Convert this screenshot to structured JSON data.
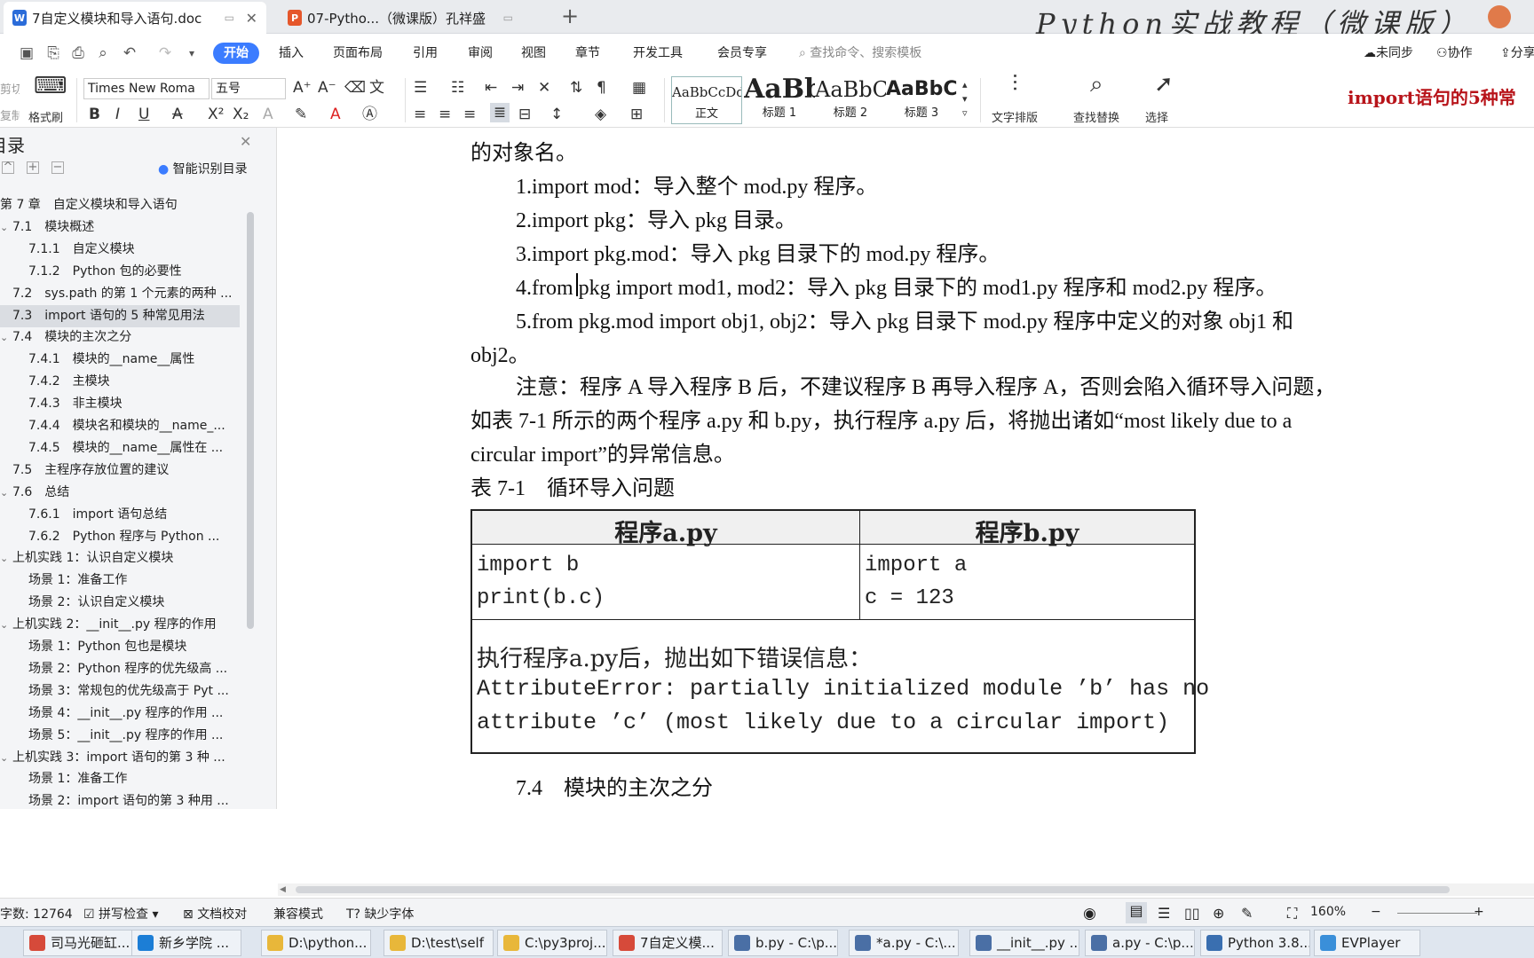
{
  "tabs": [
    {
      "label": "7自定义模块和导入语句.doc",
      "icon": "W",
      "color": "#2b6cd9"
    },
    {
      "label": "07-Pytho...（微课版）孔祥盛",
      "icon": "P",
      "color": "#e5572b"
    }
  ],
  "brand": "Python实战教程（微课版）",
  "menu": [
    "开始",
    "插入",
    "页面布局",
    "引用",
    "审阅",
    "视图",
    "章节",
    "开发工具",
    "会员专享"
  ],
  "search_placeholder": "查找命令、搜索模板",
  "menu_right": [
    "未同步",
    "协作",
    "分享"
  ],
  "ribbon": {
    "clipboard_cut": "剪切",
    "clipboard_copy": "复制",
    "format_painter": "格式刷",
    "font_name": "Times New Roma",
    "font_size": "五号",
    "styles": [
      {
        "sample": "AaBbCcDd",
        "label": "正文"
      },
      {
        "sample": "AaBb",
        "label": "标题 1"
      },
      {
        "sample": "AaBbC",
        "label": "标题 2"
      },
      {
        "sample": "AaBbC",
        "label": "标题 3"
      }
    ],
    "text_layout": "文字排版",
    "find_replace": "查找替换",
    "select": "选择",
    "overlay_text": "import语句的5种常"
  },
  "nav": {
    "title": "目录",
    "smart": "智能识别目录",
    "items": [
      {
        "text": "第 7 章　自定义模块和导入语句",
        "level": 0
      },
      {
        "text": "7.1　模块概述",
        "level": 1
      },
      {
        "text": "7.1.1　自定义模块",
        "level": 2
      },
      {
        "text": "7.1.2　Python 包的必要性",
        "level": 2
      },
      {
        "text": "7.2　sys.path 的第 1 个元素的两种 ...",
        "level": 1
      },
      {
        "text": "7.3　import 语句的 5 种常见用法",
        "level": 1
      },
      {
        "text": "7.4　模块的主次之分",
        "level": 1
      },
      {
        "text": "7.4.1　模块的__name__属性",
        "level": 2
      },
      {
        "text": "7.4.2　主模块",
        "level": 2
      },
      {
        "text": "7.4.3　非主模块",
        "level": 2
      },
      {
        "text": "7.4.4　模块名和模块的__name_...",
        "level": 2
      },
      {
        "text": "7.4.5　模块的__name__属性在 ...",
        "level": 2
      },
      {
        "text": "7.5　主程序存放位置的建议",
        "level": 1
      },
      {
        "text": "7.6　总结",
        "level": 1
      },
      {
        "text": "7.6.1　import 语句总结",
        "level": 2
      },
      {
        "text": "7.6.2　Python 程序与 Python ...",
        "level": 2
      },
      {
        "text": "上机实践 1：认识自定义模块",
        "level": 1
      },
      {
        "text": "场景 1：准备工作",
        "level": 2
      },
      {
        "text": "场景 2：认识自定义模块",
        "level": 2
      },
      {
        "text": "上机实践 2：__init__.py 程序的作用",
        "level": 1
      },
      {
        "text": "场景 1：Python 包也是模块",
        "level": 2
      },
      {
        "text": "场景 2：Python 程序的优先级高 ...",
        "level": 2
      },
      {
        "text": "场景 3：常规包的优先级高于 Pyt ...",
        "level": 2
      },
      {
        "text": "场景 4：__init__.py 程序的作用 ...",
        "level": 2
      },
      {
        "text": "场景 5：__init__.py 程序的作用 ...",
        "level": 2
      },
      {
        "text": "上机实践 3：import 语句的第 3 种 ...",
        "level": 1
      },
      {
        "text": "场景 1：准备工作",
        "level": 2
      },
      {
        "text": "场景 2：import 语句的第 3 种用 ...",
        "level": 2
      }
    ]
  },
  "doc": {
    "p0": "的对象名。",
    "p1": "1.import mod：导入整个 mod.py 程序。",
    "p2": "2.import pkg：导入 pkg 目录。",
    "p3": "3.import pkg.mod：导入 pkg 目录下的 mod.py 程序。",
    "p4": "4.from pkg import mod1, mod2：导入 pkg 目录下的 mod1.py 程序和 mod2.py 程序。",
    "p5": "5.from pkg.mod import obj1, obj2：导入 pkg 目录下 mod.py 程序中定义的对象 obj1 和",
    "p5b": "obj2。",
    "p6": "注意：程序 A 导入程序 B 后，不建议程序 B 再导入程序 A，否则会陷入循环导入问题，",
    "p6b": "如表 7-1 所示的两个程序 a.py 和 b.py，执行程序 a.py 后，将抛出诸如“most likely due to a",
    "p6c": "circular import”的异常信息。",
    "caption": "表 7-1　循环导入问题",
    "table": {
      "h1": "程序a.py",
      "h2": "程序b.py",
      "c1l1": "import b",
      "c1l2": "print(b.c)",
      "c2l1": "import a",
      "c2l2": "c = 123",
      "err_title": "执行程序a.py后，抛出如下错误信息：",
      "err1": "AttributeError: partially initialized module ’b’ has no",
      "err2": "attribute ’c’ (most likely due to a circular import)"
    },
    "heading": "7.4　模块的主次之分"
  },
  "status": {
    "wordcount": "字数: 12764",
    "spell": "拼写检查",
    "proof": "文档校对",
    "compat": "兼容模式",
    "missing_font": "缺少字体",
    "zoom": "160%"
  },
  "taskbar": [
    {
      "label": "司马光砸缸...",
      "color": "#d64a3a"
    },
    {
      "label": "新乡学院 ...",
      "color": "#1c7ed6"
    },
    {
      "label": "D:\\python...",
      "color": "#e8b73a"
    },
    {
      "label": "D:\\test\\self",
      "color": "#e8b73a"
    },
    {
      "label": "C:\\py3proj...",
      "color": "#e8b73a"
    },
    {
      "label": "7自定义模...",
      "color": "#d64a3a"
    },
    {
      "label": "b.py - C:\\p...",
      "color": "#4a6fa5"
    },
    {
      "label": "*a.py - C:\\...",
      "color": "#4a6fa5"
    },
    {
      "label": "__init__.py ...",
      "color": "#4a6fa5"
    },
    {
      "label": "a.py - C:\\p...",
      "color": "#4a6fa5"
    },
    {
      "label": "Python 3.8...",
      "color": "#3a6fb0"
    },
    {
      "label": "EVPlayer",
      "color": "#3a8fd9"
    }
  ]
}
